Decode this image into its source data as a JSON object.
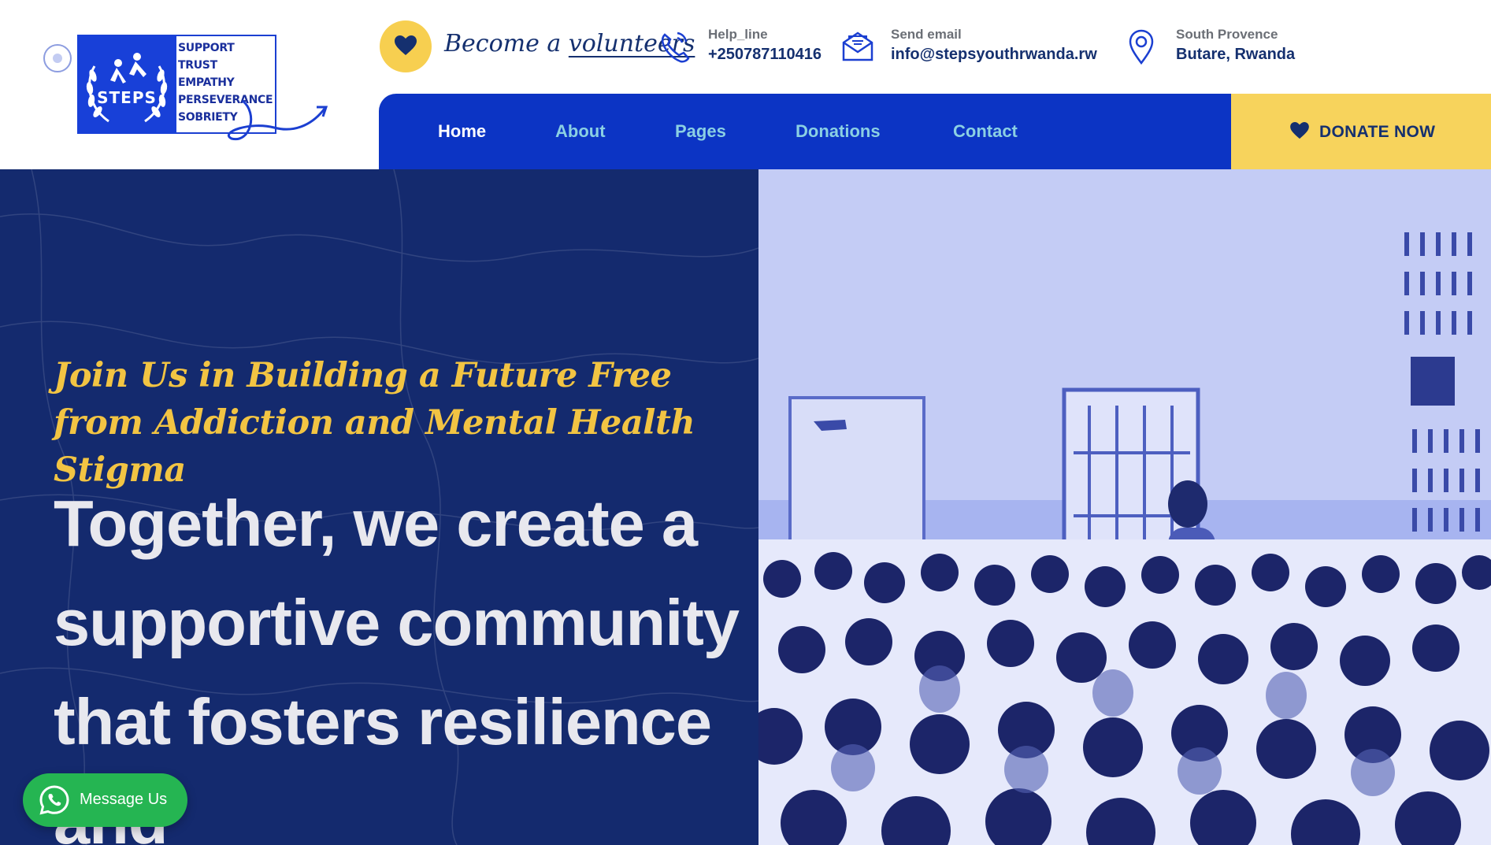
{
  "header": {
    "logo": {
      "name": "STEPS",
      "words": [
        "SUPPORT",
        "TRUST",
        "EMPATHY",
        "PERSEVERANCE",
        "SOBRIETY"
      ]
    },
    "volunteer": {
      "prefix": "Become a ",
      "link": "volunteers",
      "icon": "heart-icon"
    },
    "contacts": [
      {
        "icon": "phone-icon",
        "label": "Help_line",
        "value": "+250787110416"
      },
      {
        "icon": "envelope-icon",
        "label": "Send email",
        "value": "info@stepsyouthrwanda.rw"
      },
      {
        "icon": "location-pin-icon",
        "label": "South Provence",
        "value": "Butare, Rwanda"
      }
    ]
  },
  "nav": {
    "items": [
      "Home",
      "About",
      "Pages",
      "Donations",
      "Contact"
    ],
    "active": "Home",
    "donate_label": "DONATE NOW"
  },
  "hero": {
    "tagline": "Join Us in Building a Future Free from Addiction and Mental Health Stigma",
    "headline": "Together, we create a supportive community that fosters resilience and"
  },
  "message_button": {
    "label": "Message Us",
    "icon": "whatsapp-icon"
  },
  "colors": {
    "nav_blue": "#0c34c4",
    "hero_navy": "#142a6e",
    "accent_yellow": "#f7d35c",
    "tagline_gold": "#f2c443",
    "whatsapp_green": "#25b552"
  }
}
